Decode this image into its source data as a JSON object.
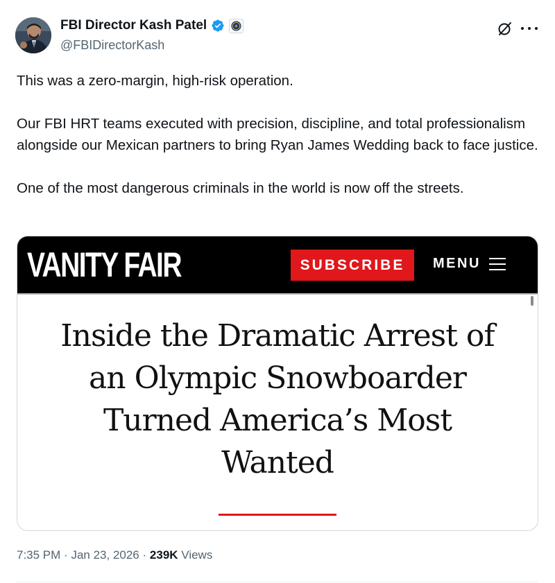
{
  "author": {
    "display_name": "FBI Director Kash Patel",
    "handle": "@FBIDirectorKash",
    "verified": true
  },
  "tweet": {
    "paragraphs": [
      "This was a zero-margin, high-risk operation.",
      "Our FBI HRT teams executed with precision, discipline, and total professionalism alongside our Mexican partners to bring Ryan James Wedding back to face justice.",
      "One of the most dangerous criminals in the world is now off the streets."
    ]
  },
  "card": {
    "logo": "VANITY FAIR",
    "subscribe_label": "SUBSCRIBE",
    "menu_label": "MENU",
    "headline": "Inside the Dramatic Arrest of an Olympic Snowboarder Turned America’s Most Wanted"
  },
  "meta": {
    "time": "7:35 PM",
    "separator": "·",
    "date": "Jan 23, 2026",
    "views_count": "239K",
    "views_label": "Views"
  },
  "colors": {
    "text_primary": "#0f1419",
    "text_secondary": "#536471",
    "verified_blue": "#1d9bf0",
    "vf_red": "#e0171b",
    "vf_black": "#000000"
  },
  "icons": {
    "header_right": [
      "grok-icon",
      "more-options-icon"
    ],
    "name_badges": [
      "verified-badge-icon",
      "fbi-seal-icon"
    ]
  }
}
